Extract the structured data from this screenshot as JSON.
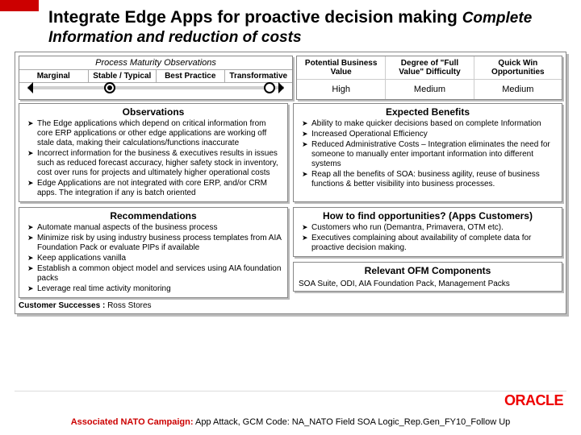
{
  "title": {
    "line1": "Integrate Edge Apps for proactive decision making",
    "line2": "Complete Information and reduction of costs"
  },
  "process_maturity": {
    "title": "Process Maturity Observations",
    "levels": [
      "Marginal",
      "Stable / Typical",
      "Best Practice",
      "Transformative"
    ]
  },
  "value_table": {
    "headers": [
      "Potential Business Value",
      "Degree of \"Full Value\" Difficulty",
      "Quick Win Opportunities"
    ],
    "values": [
      "High",
      "Medium",
      "Medium"
    ]
  },
  "observations": {
    "heading": "Observations",
    "items": [
      "The Edge applications which depend on critical information from core ERP applications or other edge applications are working off stale data, making their calculations/functions inaccurate",
      "Incorrect information for the business & executives results in issues such as reduced forecast accuracy, higher safety stock in inventory, cost over runs for projects and ultimately higher operational costs",
      "Edge Applications are not integrated with core ERP, and/or CRM apps. The integration if any is batch oriented"
    ]
  },
  "benefits": {
    "heading": "Expected Benefits",
    "items": [
      "Ability to make quicker decisions based on complete Information",
      "Increased Operational Efficiency",
      "Reduced Administrative Costs – Integration eliminates the need for someone to manually enter important information into different systems",
      "Reap all the benefits of SOA: business agility, reuse of business functions & better visibility into business processes."
    ]
  },
  "recommendations": {
    "heading": "Recommendations",
    "items": [
      "Automate manual aspects of the business process",
      "Minimize risk by using industry business process templates from AIA Foundation Pack or evaluate PIPs if available",
      "Keep applications vanilla",
      "Establish a common object model and services using AIA foundation packs",
      "Leverage real time activity monitoring"
    ]
  },
  "howto": {
    "heading": "How to find opportunities? (Apps Customers)",
    "items": [
      "Customers who run (Demantra, Primavera, OTM etc).",
      "Executives complaining about availability of complete data for proactive decision making."
    ]
  },
  "fm": {
    "heading": "Relevant OFM Components",
    "text": "SOA Suite, ODI, AIA Foundation Pack, Management Packs"
  },
  "customer_successes": {
    "label": "Customer Successes :",
    "value": "Ross Stores"
  },
  "logo": "ORACLE",
  "footer": {
    "label": "Associated NATO Campaign:",
    "text": " App Attack, GCM Code: NA_NATO Field SOA Logic_Rep.Gen_FY10_Follow Up"
  }
}
